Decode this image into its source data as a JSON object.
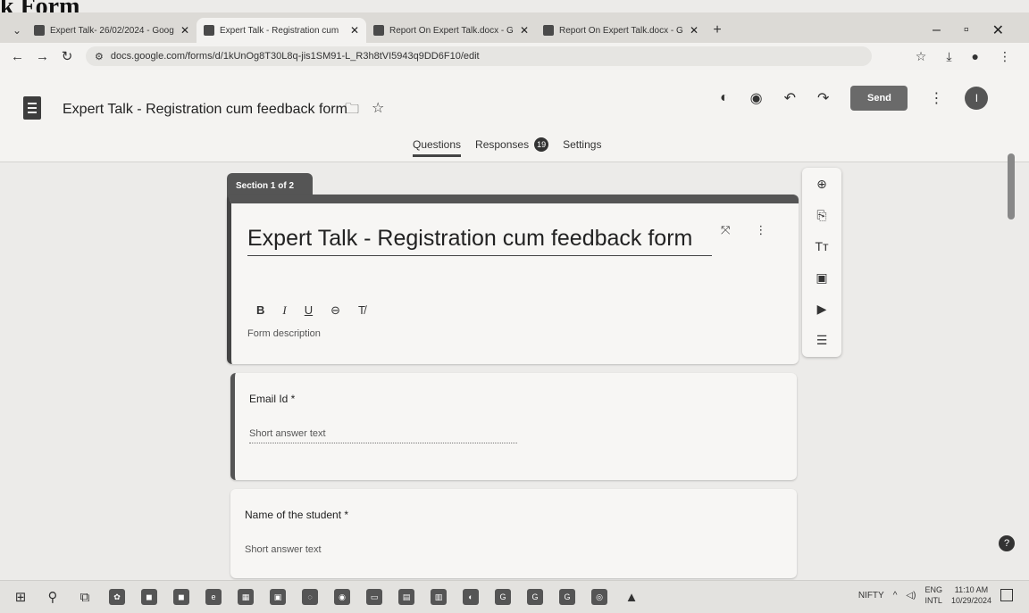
{
  "document_heading": "k Form",
  "browser": {
    "tabs": [
      {
        "title": "Expert Talk- 26/02/2024 - Goog",
        "active": false
      },
      {
        "title": "Expert Talk - Registration cum",
        "active": true
      },
      {
        "title": "Report On Expert Talk.docx - G",
        "active": false
      },
      {
        "title": "Report On Expert Talk.docx - G",
        "active": false
      }
    ],
    "url": "docs.google.com/forms/d/1kUnOg8T30L8q-jis1SM91-L_R3h8tVI5943q9DD6F10/edit"
  },
  "forms_header": {
    "title": "Expert Talk - Registration cum feedback form",
    "send_label": "Send",
    "avatar_initial": "I",
    "tabs": {
      "questions": "Questions",
      "responses": "Responses",
      "responses_count": "19",
      "settings": "Settings"
    }
  },
  "form": {
    "section_label": "Section 1 of 2",
    "title": "Expert Talk - Registration cum feedback form",
    "description_placeholder": "Form description",
    "format_tools": [
      "B",
      "I",
      "U",
      "⊖",
      "T̸"
    ],
    "questions": [
      {
        "label": "Email Id *",
        "placeholder": "Short answer text"
      },
      {
        "label": "Name of the student *",
        "placeholder": "Short answer text"
      }
    ]
  },
  "taskbar": {
    "ticker": "NIFTY",
    "lang_top": "ENG",
    "lang_bottom": "INTL",
    "time": "11:10 AM",
    "date": "10/29/2024"
  },
  "accent": "#555555"
}
